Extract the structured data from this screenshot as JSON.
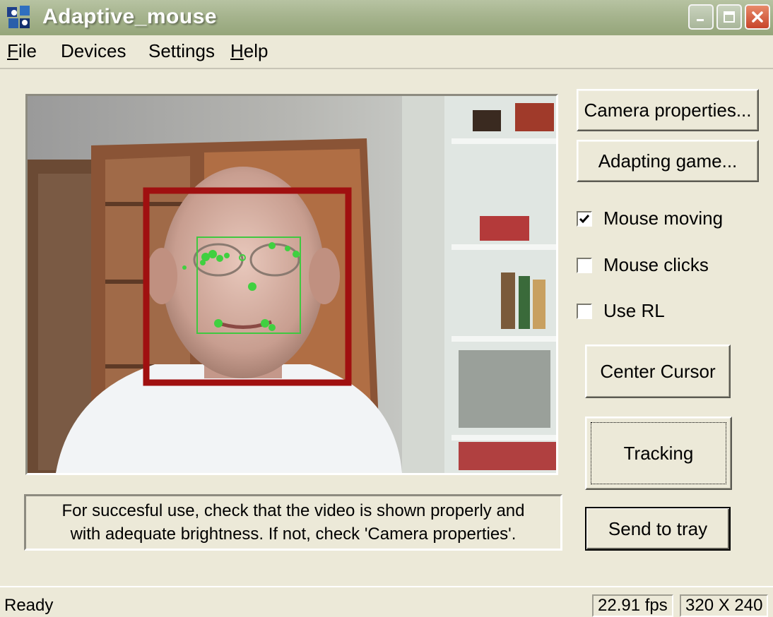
{
  "window": {
    "title": "Adaptive_mouse",
    "controls": {
      "minimize": "minimize-icon",
      "maximize": "maximize-icon",
      "close": "close-icon"
    },
    "accent": "#a6b48e",
    "close_color": "#c8452a"
  },
  "menu": {
    "items": [
      {
        "label": "File",
        "mnemonic": "F",
        "rest": "ile"
      },
      {
        "label": "Devices"
      },
      {
        "label": "Settings"
      },
      {
        "label": "Help",
        "mnemonic": "H",
        "rest": "elp"
      }
    ]
  },
  "video": {
    "face_box_color": "#a01010",
    "feature_box_color": "#40c840"
  },
  "buttons": {
    "camera_properties": "Camera properties...",
    "adapting_game": "Adapting game...",
    "center_cursor": "Center Cursor",
    "tracking": "Tracking",
    "send_to_tray": "Send to tray"
  },
  "checkboxes": [
    {
      "label": "Mouse moving",
      "checked": true
    },
    {
      "label": "Mouse clicks",
      "checked": false
    },
    {
      "label": "Use RL",
      "checked": false
    }
  ],
  "message": {
    "line1": "For succesful use, check that the video is shown properly and",
    "line2": "with adequate brightness. If not, check 'Camera properties'."
  },
  "status": {
    "text": "Ready",
    "fps": "22.91 fps",
    "resolution": "320 X 240"
  }
}
